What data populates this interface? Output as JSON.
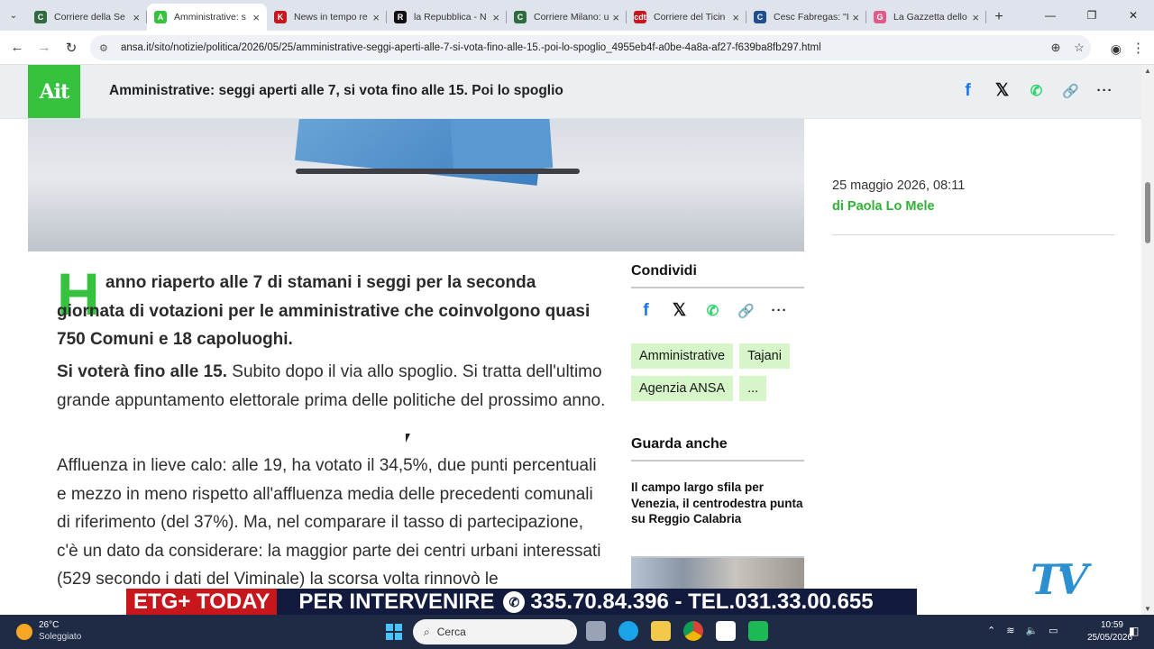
{
  "browser": {
    "tabs": [
      {
        "title": "Corriere della Se",
        "favicon": "C",
        "color": "#2f6b3f",
        "active": false
      },
      {
        "title": "Amministrative: s",
        "favicon": "A",
        "color": "#36c23e",
        "active": true
      },
      {
        "title": "News in tempo re",
        "favicon": "K",
        "color": "#c8161d",
        "active": false
      },
      {
        "title": "la Repubblica - N",
        "favicon": "R",
        "color": "#111111",
        "active": false
      },
      {
        "title": "Corriere Milano: u",
        "favicon": "C",
        "color": "#2f6b3f",
        "active": false
      },
      {
        "title": "Corriere del Ticin",
        "favicon": "cdt",
        "color": "#c8161d",
        "active": false
      },
      {
        "title": "Cesc Fabregas: \"I",
        "favicon": "C",
        "color": "#1f4f8f",
        "active": false
      },
      {
        "title": "La Gazzetta dello",
        "favicon": "G",
        "color": "#e05b8a",
        "active": false
      }
    ],
    "new_tab": "+",
    "url": "ansa.it/sito/notizie/politica/2026/05/25/amministrative-seggi-aperti-alle-7-si-vota-fino-alle-15.-poi-lo-spoglio_4955eb4f-a0be-4a8a-af27-f639ba8fb297.html"
  },
  "site": {
    "logo": "Ait",
    "header_title": "Amministrative: seggi aperti alle 7, si vota fino alle 15. Poi lo spoglio",
    "share_icons": [
      "facebook-icon",
      "x-icon",
      "whatsapp-icon",
      "link-icon",
      "more-icon"
    ]
  },
  "article": {
    "dropcap": "H",
    "lead": "anno riaperto alle 7 di stamani i seggi per la seconda giornata di votazioni per le amministrative che coinvolgono quasi 750 Comuni e 18 capoluoghi.",
    "para1_bold": "Si voterà fino alle 15.",
    "para1_rest": " Subito dopo il via allo spoglio. Si tratta dell'ultimo grande appuntamento elettorale prima delle politiche del prossimo anno.",
    "para2": "Affluenza in lieve calo: alle 19, ha votato il 34,5%, due punti percentuali e mezzo in meno rispetto all'affluenza media delle precedenti comunali di riferimento (del 37%). Ma, nel comparare il tasso di partecipazione, c'è un dato da considerare: la maggior parte dei centri urbani interessati (529 secondo i dati del Viminale) la scorsa volta rinnovò le"
  },
  "meta": {
    "date": "25 maggio 2026, 08:11",
    "author": "di Paola Lo Mele"
  },
  "sidebar": {
    "share_title": "Condividi",
    "tags": [
      "Amministrative",
      "Tajani",
      "Agenzia ANSA",
      "..."
    ],
    "see_also_title": "Guarda anche",
    "related_title": "Il campo largo sfila per Venezia, il centrodestra punta su Reggio Calabria"
  },
  "overlay": {
    "ticker_brand": "ETG+ TODAY",
    "ticker_text_1": "PER INTERVENIRE",
    "ticker_text_2": "335.70.84.396 - TEL.031.33.00.655",
    "tv_logo": "TV"
  },
  "taskbar": {
    "temperature": "26°C",
    "weather": "Soleggiato",
    "search_placeholder": "Cerca",
    "time": "10:59",
    "date": "25/05/2026"
  }
}
